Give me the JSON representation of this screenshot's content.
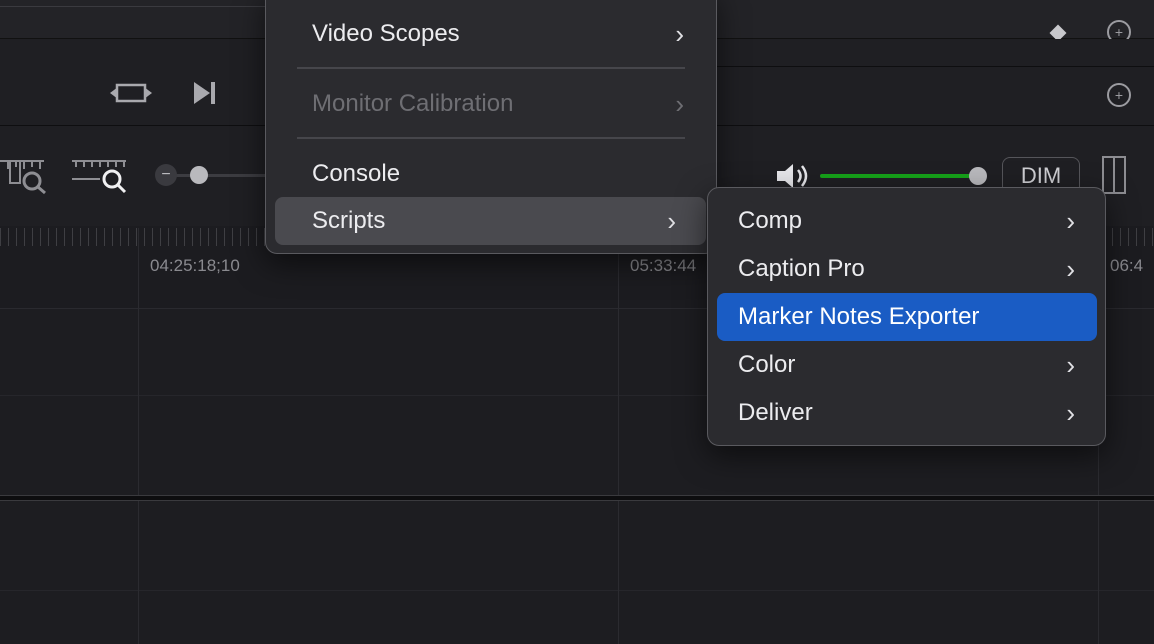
{
  "timeline": {
    "timecodes": [
      "04:25:18;10",
      "05:33:44",
      "06:4"
    ]
  },
  "main_menu": {
    "items": [
      {
        "label": "Video Scopes",
        "has_submenu": true,
        "enabled": true
      },
      {
        "label": "Monitor Calibration",
        "has_submenu": true,
        "enabled": false
      },
      {
        "label": "Console",
        "has_submenu": false,
        "enabled": true
      },
      {
        "label": "Scripts",
        "has_submenu": true,
        "enabled": true,
        "highlighted": true
      }
    ],
    "chevron": "›"
  },
  "scripts_submenu": {
    "items": [
      {
        "label": "Comp",
        "has_submenu": true
      },
      {
        "label": "Caption Pro",
        "has_submenu": true
      },
      {
        "label": "Marker Notes Exporter",
        "has_submenu": false,
        "selected": true
      },
      {
        "label": "Color",
        "has_submenu": true
      },
      {
        "label": "Deliver",
        "has_submenu": true
      }
    ]
  },
  "audio": {
    "dim_label": "DIM",
    "volume_color": "#16a31a"
  },
  "colors": {
    "selected": "#1a5cc4",
    "menu_bg": "#2b2b2f",
    "hover": "#4a4a4f"
  },
  "icons": [
    "loop-icon",
    "next-frame-icon",
    "zoom-fit-icon",
    "zoom-detail-icon",
    "speaker-icon",
    "keyframe-diamond-icon",
    "reset-icon",
    "split-view-icon"
  ]
}
